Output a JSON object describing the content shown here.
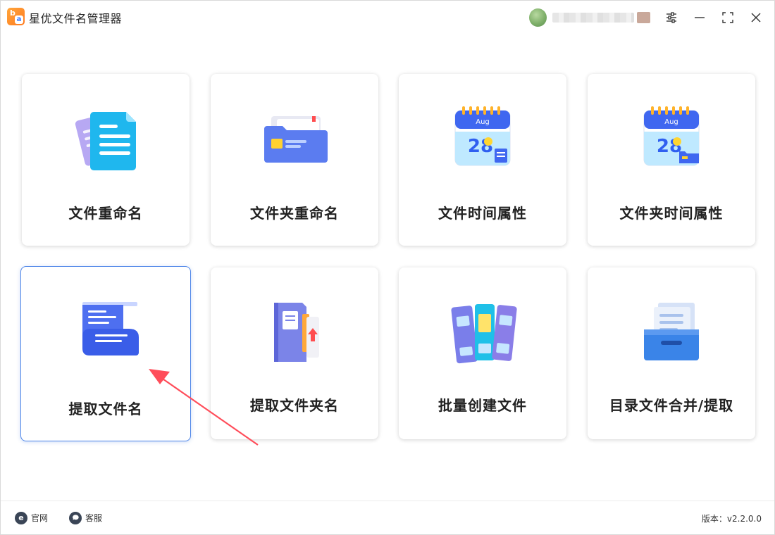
{
  "app": {
    "title": "星优文件名管理器",
    "logo_letters": [
      "b",
      "a"
    ]
  },
  "window_controls": [
    {
      "name": "settings-icon",
      "label": "settings"
    },
    {
      "name": "minimize-icon",
      "label": "minimize"
    },
    {
      "name": "maximize-icon",
      "label": "maximize"
    },
    {
      "name": "close-icon",
      "label": "close"
    }
  ],
  "tools": [
    {
      "id": "file-rename",
      "label": "文件重命名",
      "icon": "documents-icon",
      "selected": false
    },
    {
      "id": "folder-rename",
      "label": "文件夹重命名",
      "icon": "folder-icon",
      "selected": false
    },
    {
      "id": "file-time",
      "label": "文件时间属性",
      "icon": "calendar-icon",
      "selected": false
    },
    {
      "id": "folder-time",
      "label": "文件夹时间属性",
      "icon": "calendar-folder-icon",
      "selected": false
    },
    {
      "id": "extract-filename",
      "label": "提取文件名",
      "icon": "scroll-document-icon",
      "selected": true
    },
    {
      "id": "extract-foldername",
      "label": "提取文件夹名",
      "icon": "binder-icon",
      "selected": false
    },
    {
      "id": "batch-create",
      "label": "批量创建文件",
      "icon": "books-icon",
      "selected": false
    },
    {
      "id": "dir-merge",
      "label": "目录文件合并/提取",
      "icon": "file-tray-icon",
      "selected": false
    }
  ],
  "calendar_month": "Aug",
  "calendar_day": "28",
  "footer": {
    "website_label": "官网",
    "support_label": "客服",
    "version_text": "版本：v2.2.0.0"
  },
  "colors": {
    "accent_blue": "#4f86e8",
    "logo_orange": "#ff8a25"
  }
}
